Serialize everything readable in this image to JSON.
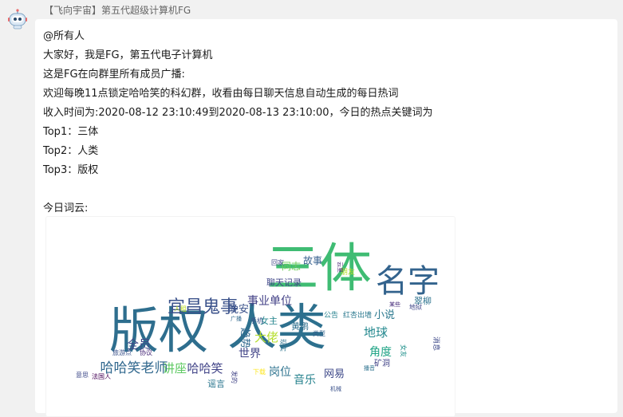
{
  "message": {
    "sender": "【飞向宇宙】第五代超级计算机FG",
    "lines": [
      "@所有人",
      "大家好，我是FG，第五代电子计算机",
      "这是FG在向群里所有成员广播:",
      "欢迎每晚11点锁定哈哈笑的科幻群，收看由每日聊天信息自动生成的每日热词",
      "收入时间为:2020-08-12 23:10:49到2020-08-13 23:10:00，今日的热点关键词为",
      "Top1：三体",
      "Top2：人类",
      "Top3：版权",
      "",
      "今日词云:"
    ]
  },
  "wordcloud": {
    "words": [
      {
        "text": "版权",
        "color": "#2e6e8e"
      },
      {
        "text": "人类",
        "color": "#2d708e"
      },
      {
        "text": "三体",
        "color": "#3fbc73"
      },
      {
        "text": "名字",
        "color": "#33638d"
      },
      {
        "text": "宜昌鬼事",
        "color": "#3b528b"
      },
      {
        "text": "哈哈笑老师",
        "color": "#31688e"
      },
      {
        "text": "讲座",
        "color": "#5ec962"
      },
      {
        "text": "哈哈笑",
        "color": "#404387"
      },
      {
        "text": "全员",
        "color": "#3e4a89"
      },
      {
        "text": "事业单位",
        "color": "#424086"
      },
      {
        "text": "地球",
        "color": "#23888e"
      },
      {
        "text": "小说",
        "color": "#2a788e"
      },
      {
        "text": "大佬",
        "color": "#b5de2b"
      },
      {
        "text": "角度",
        "color": "#20a486"
      },
      {
        "text": "世界",
        "color": "#414487"
      },
      {
        "text": "音乐",
        "color": "#26828e"
      },
      {
        "text": "岗位",
        "color": "#2c728e"
      },
      {
        "text": "网易",
        "color": "#3e4989"
      },
      {
        "text": "晚安",
        "color": "#3b528b"
      },
      {
        "text": "故事",
        "color": "#355f8d"
      },
      {
        "text": "同志",
        "color": "#6ece58"
      },
      {
        "text": "聊天记录",
        "color": "#404688"
      },
      {
        "text": "翠柳",
        "color": "#2c728e"
      },
      {
        "text": "女主",
        "color": "#25858e"
      },
      {
        "text": "黄鹏",
        "color": "#2e6f8e"
      },
      {
        "text": "趋势",
        "color": "#31688e"
      },
      {
        "text": "谣言",
        "color": "#2a768e"
      },
      {
        "text": "回家",
        "color": "#414487"
      },
      {
        "text": "手机",
        "color": "#3b528b"
      },
      {
        "text": "朋友",
        "color": "#b5de2b"
      },
      {
        "text": "公告",
        "color": "#26828e"
      },
      {
        "text": "红杏出墙",
        "color": "#2a788e"
      },
      {
        "text": "消息",
        "color": "#3e4a89"
      },
      {
        "text": "矿洞",
        "color": "#404387"
      },
      {
        "text": "旅游点",
        "color": "#3b528b"
      },
      {
        "text": "协议",
        "color": "#482878"
      },
      {
        "text": "意思",
        "color": "#3e4989"
      },
      {
        "text": "法国人",
        "color": "#440154"
      },
      {
        "text": "人租",
        "color": "#bddf26"
      },
      {
        "text": "广播",
        "color": "#31688e"
      },
      {
        "text": "现实",
        "color": "#2c728e"
      },
      {
        "text": "类型",
        "color": "#33638d"
      },
      {
        "text": "地狱",
        "color": "#404688"
      },
      {
        "text": "云里",
        "color": "#482475"
      },
      {
        "text": "女友",
        "color": "#21918c"
      },
      {
        "text": "下载",
        "color": "#fde725"
      },
      {
        "text": "机械",
        "color": "#3b528b"
      },
      {
        "text": "播音",
        "color": "#2c728e"
      },
      {
        "text": "某些",
        "color": "#472d7b"
      },
      {
        "text": "发的",
        "color": "#414487"
      }
    ]
  }
}
